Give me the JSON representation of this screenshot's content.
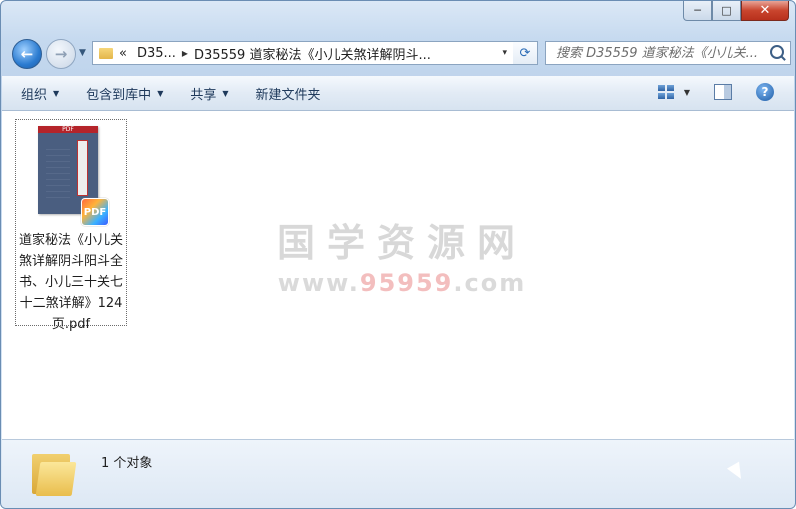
{
  "window": {
    "minimize_glyph": "─",
    "maximize_glyph": "□",
    "close_glyph": "✕"
  },
  "address_bar": {
    "overflow_glyph": "«",
    "crumbs": [
      "D35...",
      "D35559 道家秘法《小儿关煞详解阴斗..."
    ],
    "separator": "▸",
    "dropdown_glyph": "▾",
    "refresh_glyph": "⟳"
  },
  "search": {
    "placeholder": "搜索 D35559 道家秘法《小儿关..."
  },
  "toolbar": {
    "organize": "组织",
    "include_in_library": "包含到库中",
    "share": "共享",
    "new_folder": "新建文件夹",
    "dropdown_glyph": "▼",
    "help_glyph": "?"
  },
  "content": {
    "files": [
      {
        "name": "道家秘法《小儿关煞详解阴斗阳斗全书、小儿三十关七十二煞详解》124页.pdf",
        "type_badge": "PDF",
        "thumb_header": "PDF"
      }
    ],
    "watermark": {
      "title": "国学资源网",
      "url_prefix": "www.",
      "url_accent": "95959",
      "url_suffix": ".com"
    }
  },
  "status_bar": {
    "object_count": "1 个对象"
  }
}
